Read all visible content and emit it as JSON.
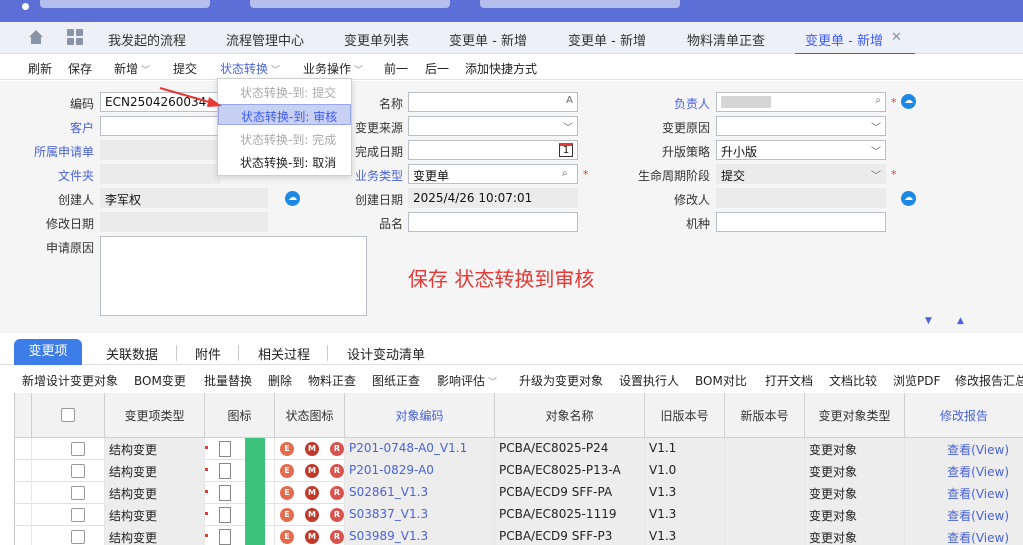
{
  "colors": {
    "accent": "#3d5afe",
    "link": "#4a63d8",
    "topbar": "#5b6fd6",
    "required": "#e53935",
    "tab_active_bg": "#3d7de8"
  },
  "tabs": [
    "我发起的流程",
    "流程管理中心",
    "变更单列表",
    "变更单 - 新增",
    "变更单 - 新增",
    "物料清单正查",
    "变更单 - 新增"
  ],
  "tabs_close": "✕",
  "toolbar": {
    "refresh": "刷新",
    "save": "保存",
    "new": "新增",
    "submit": "提交",
    "state": "状态转换",
    "biz": "业务操作",
    "prev": "前一",
    "next": "后一",
    "shortcut": "添加快捷方式"
  },
  "dropdown": {
    "items": [
      "状态转换-到: 提交",
      "状态转换-到: 审核",
      "状态转换-到: 完成",
      "状态转换-到: 取消"
    ]
  },
  "form": {
    "code_label": "编码",
    "code_value": "ECN2504260034",
    "customer_label": "客户",
    "apply_label": "所属申请单",
    "folder_label": "文件夹",
    "creator_label": "创建人",
    "creator_value": "李军权",
    "modify_date_label": "修改日期",
    "reason_label": "申请原因",
    "name_label": "名称",
    "source_label": "变更来源",
    "finish_label": "完成日期",
    "finish_day": "1",
    "biztype_label": "业务类型",
    "biztype_value": "变更单",
    "create_date_label": "创建日期",
    "create_date_value": "2025/4/26 10:07:01",
    "product_label": "品名",
    "owner_label": "负责人",
    "change_reason_label": "变更原因",
    "upgrade_label": "升版策略",
    "upgrade_value": "升小版",
    "lifecycle_label": "生命周期阶段",
    "lifecycle_value": "提交",
    "modifier_label": "修改人",
    "model_label": "机种"
  },
  "note": "保存 状态转换到审核",
  "subtabs": [
    "变更项",
    "关联数据",
    "附件",
    "相关过程",
    "设计变动清单"
  ],
  "subtoolbar": [
    "新增设计变更对象",
    "BOM变更",
    "批量替换",
    "删除",
    "物料正查",
    "图纸正查",
    "影响评估",
    "升级为变更对象",
    "设置执行人",
    "BOM对比",
    "打开文档",
    "文档比较",
    "浏览PDF",
    "修改报告汇总"
  ],
  "columns": [
    "变更项类型",
    "图标",
    "状态图标",
    "对象编码",
    "对象名称",
    "旧版本号",
    "新版本号",
    "变更对象类型",
    "修改报告"
  ],
  "rows": [
    {
      "type": "结构变更",
      "code": "P201-0748-A0_V1.1",
      "name": "PCBA/EC8025-P24",
      "old": "V1.1",
      "new": "",
      "objtype": "变更对象",
      "report": "查看(View)"
    },
    {
      "type": "结构变更",
      "code": "P201-0829-A0",
      "name": "PCBA/EC8025-P13-A",
      "old": "V1.0",
      "new": "",
      "objtype": "变更对象",
      "report": "查看(View)"
    },
    {
      "type": "结构变更",
      "code": "S02861_V1.3",
      "name": "PCBA/ECD9 SFF-PA",
      "old": "V1.3",
      "new": "",
      "objtype": "变更对象",
      "report": "查看(View)"
    },
    {
      "type": "结构变更",
      "code": "S03837_V1.3",
      "name": "PCBA/EC8025-1119",
      "old": "V1.3",
      "new": "",
      "objtype": "变更对象",
      "report": "查看(View)"
    },
    {
      "type": "结构变更",
      "code": "S03989_V1.3",
      "name": "PCBA/ECD9 SFF-P3",
      "old": "V1.3",
      "new": "",
      "objtype": "变更对象",
      "report": "查看(View)"
    }
  ],
  "status_icons": [
    "E",
    "M",
    "R"
  ],
  "scroll_down": "▼",
  "scroll_up": "▲"
}
